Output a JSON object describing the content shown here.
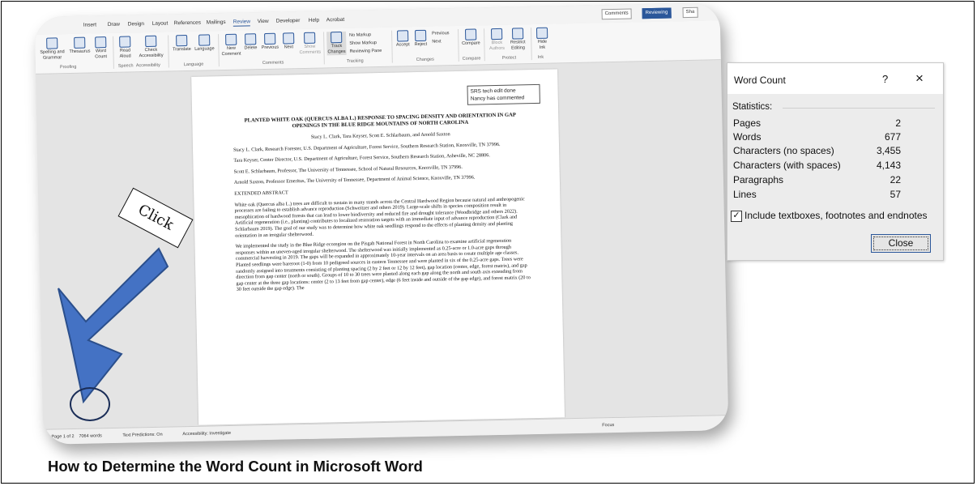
{
  "ribbon": {
    "tabs": [
      "Insert",
      "Draw",
      "Design",
      "Layout",
      "References",
      "Mailings",
      "Review",
      "View",
      "Developer",
      "Help",
      "Acrobat"
    ],
    "active_tab": "Review",
    "right_buttons": {
      "comments": "Comments",
      "reviewing": "Reviewing",
      "share": "Sha"
    },
    "buttons": {
      "spelling": "Spelling and Grammar",
      "thesaurus": "Thesaurus",
      "word_count": "Word Count",
      "read_aloud": "Read Aloud",
      "check_accessibility": "Check Accessibility",
      "translate": "Translate",
      "language": "Language",
      "new_comment": "New Comment",
      "delete": "Delete",
      "previous": "Previous",
      "next": "Next",
      "show_comments": "Show Comments",
      "track_changes": "Track Changes",
      "no_markup": "No Markup",
      "show_markup": "Show Markup",
      "reviewing_pane": "Reviewing Pane",
      "accept": "Accept",
      "reject": "Reject",
      "prev_change": "Previous",
      "next_change": "Next",
      "compare": "Compare",
      "block_authors": "Block Authors",
      "restrict_editing": "Restrict Editing",
      "hide_ink": "Hide Ink"
    },
    "groups": {
      "proofing": "Proofing",
      "speech": "Speech",
      "accessibility": "Accessibility",
      "language": "Language",
      "comments": "Comments",
      "tracking": "Tracking",
      "changes": "Changes",
      "compare": "Compare",
      "protect": "Protect",
      "ink": "Ink"
    }
  },
  "document": {
    "comment_line1": "SRS tech edit done",
    "comment_line2": "Nancy has commented",
    "title": "PLANTED WHITE OAK (QUERCUS ALBA L.) RESPONSE TO SPACING DENSITY AND ORIENTATION IN GAP OPENINGS IN THE BLUE RIDGE MOUNTAINS OF NORTH CAROLINA",
    "authors": "Stacy L. Clark, Tara Keyser, Scott E. Schlarbaum, and Arnold Saxton",
    "affil1": "Stacy L. Clark, Research Forester, U.S. Department of Agriculture, Forest Service, Southern Research Station, Knoxville, TN 37996.",
    "affil2": "Tara Keyser, Center Director, U.S. Department of Agriculture, Forest Service, Southern Research Station, Asheville, NC 28806.",
    "affil3": "Scott E. Schlarbaum, Professor, The University of Tennessee, School of Natural Resources, Knoxville, TN 37996.",
    "affil4": "Arnold Saxton, Professor Emeritus, The University of Tennessee, Department of Animal Science, Knoxville, TN 37996.",
    "section": "EXTENDED ABSTRACT",
    "para1": "White oak (Quercus alba L.) trees are difficult to sustain in many stands across the Central Hardwood Region because natural and anthropogenic processes are failing to establish advance reproduction (Schweitzer and others 2019). Large-scale shifts in species composition result in mesophication of hardwood forests that can lead to lower biodiversity and reduced fire and drought tolerance (Woodbridge and others 2022). Artificial regeneration (i.e., planting) contributes to localized restoration targets with an immediate input of advance reproduction (Clark and Schlarbaum 2019). The goal of our study was to determine how white oak seedlings respond to the effects of planting density and planting orientation in an irregular shelterwood.",
    "para2": "We implemented the study in the Blue Ridge ecoregion on the Pisgah National Forest in North Carolina to examine artificial regeneration responses within an uneven-aged irregular shelterwood. The shelterwood was initially implemented as 0.25-acre or 1.0-acre gaps through commercial harvesting in 2019. The gaps will be expanded in approximately 10-year intervals on an area basis to create multiple age classes. Planted seedlings were bareroot (1-0) from 10 pedigreed sources in eastern Tennessee and were planted in six of the 0.25-acre gaps. Trees were randomly assigned into treatments consisting of planting spacing (2 by 2 feet or 12 by 12 feet), gap location (center, edge, forest matrix), and gap direction from gap center (north or south). Groups of 10 to 30 trees were planted along each gap along the north and south axis extending from gap center at the three gap locations: center (2 to 13 feet from gap center), edge (6 feet inside and outside of the gap edge), and forest matrix (20 to 30 feet outside the gap edge). The"
  },
  "status_bar": {
    "page": "Page 1 of 2",
    "words": "7064 words",
    "text_predictions": "Text Predictions: On",
    "accessibility": "Accessibility: Investigate",
    "focus": "Focus"
  },
  "callout": {
    "click_label": "Click"
  },
  "word_count_dialog": {
    "title": "Word Count",
    "help": "?",
    "close_x": "×",
    "statistics_label": "Statistics:",
    "rows": [
      {
        "label": "Pages",
        "value": "2"
      },
      {
        "label": "Words",
        "value": "677"
      },
      {
        "label": "Characters (no spaces)",
        "value": "3,455"
      },
      {
        "label": "Characters (with spaces)",
        "value": "4,143"
      },
      {
        "label": "Paragraphs",
        "value": "22"
      },
      {
        "label": "Lines",
        "value": "57"
      }
    ],
    "checkbox_label": "Include textboxes, footnotes and endnotes",
    "checkbox_checked": true,
    "checkbox_mark": "✓",
    "close_button": "Close"
  },
  "caption": "How to Determine the Word Count in Microsoft Word"
}
